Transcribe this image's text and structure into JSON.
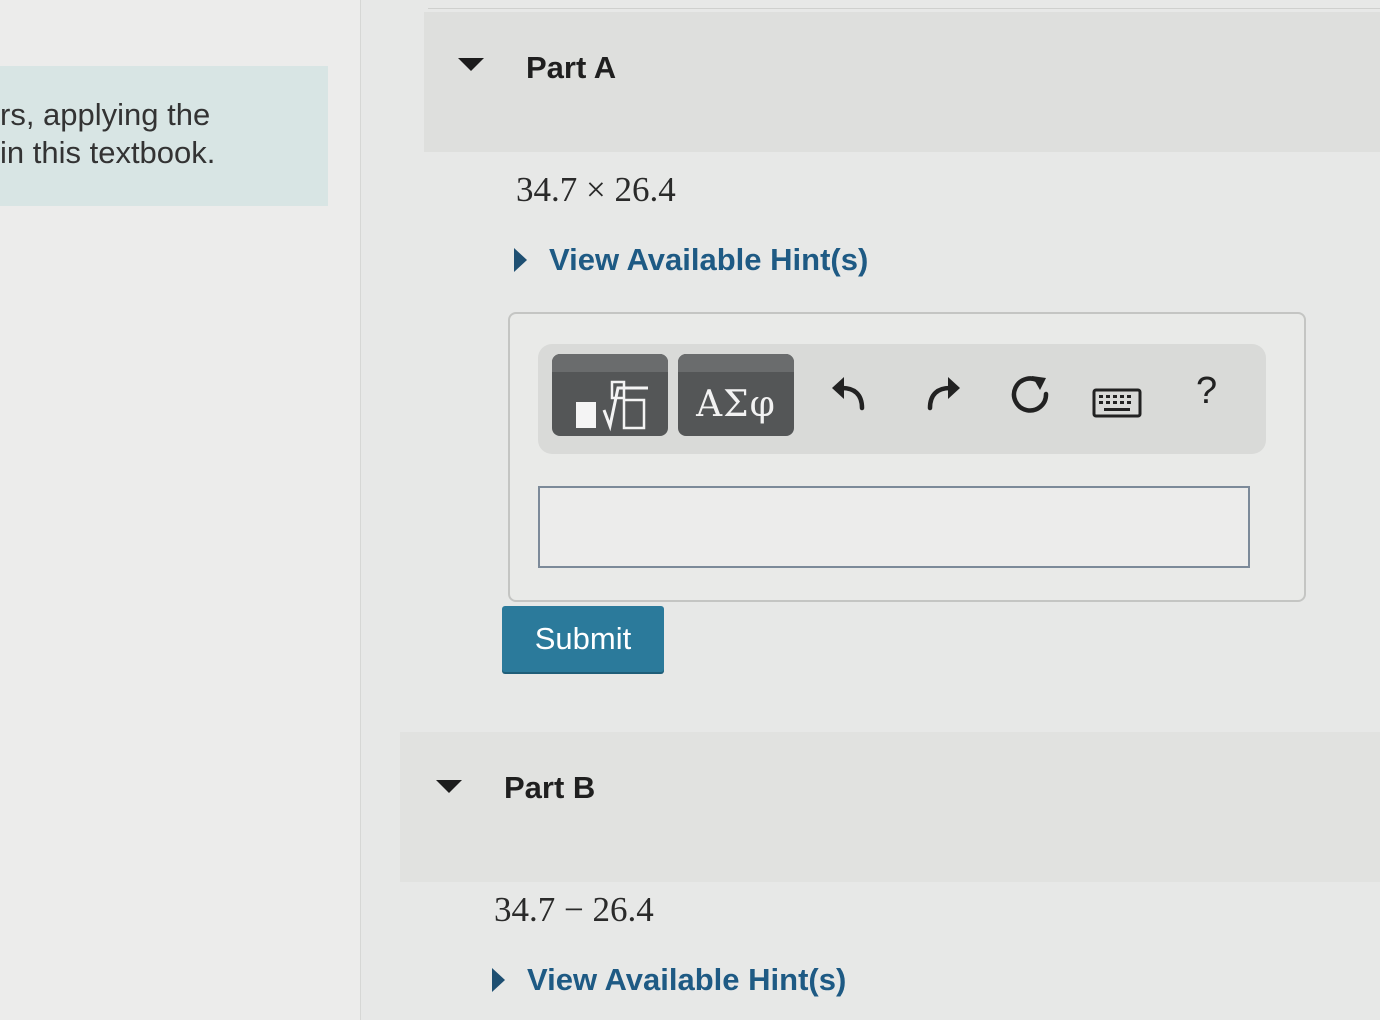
{
  "intro": {
    "lines": "rs, applying the\nin this textbook."
  },
  "part_a": {
    "title": "Part A",
    "expression": "34.7 × 26.4",
    "hint_label": "View Available Hint(s)"
  },
  "toolbar": {
    "symbols_label": "ΑΣφ",
    "help_label": "?",
    "icons": [
      "templates-icon",
      "undo-icon",
      "redo-icon",
      "reset-icon",
      "keyboard-icon",
      "help-icon"
    ]
  },
  "answer_input": {
    "value": ""
  },
  "submit": {
    "label": "Submit",
    "color": "#2b7a9b"
  },
  "part_b": {
    "title": "Part B",
    "expression": "34.7 − 26.4",
    "hint_label": "View Available Hint(s)"
  },
  "colors": {
    "link": "#1e5a84",
    "header_bg": "#dedfdd",
    "intro_bg": "#d8e5e4"
  }
}
